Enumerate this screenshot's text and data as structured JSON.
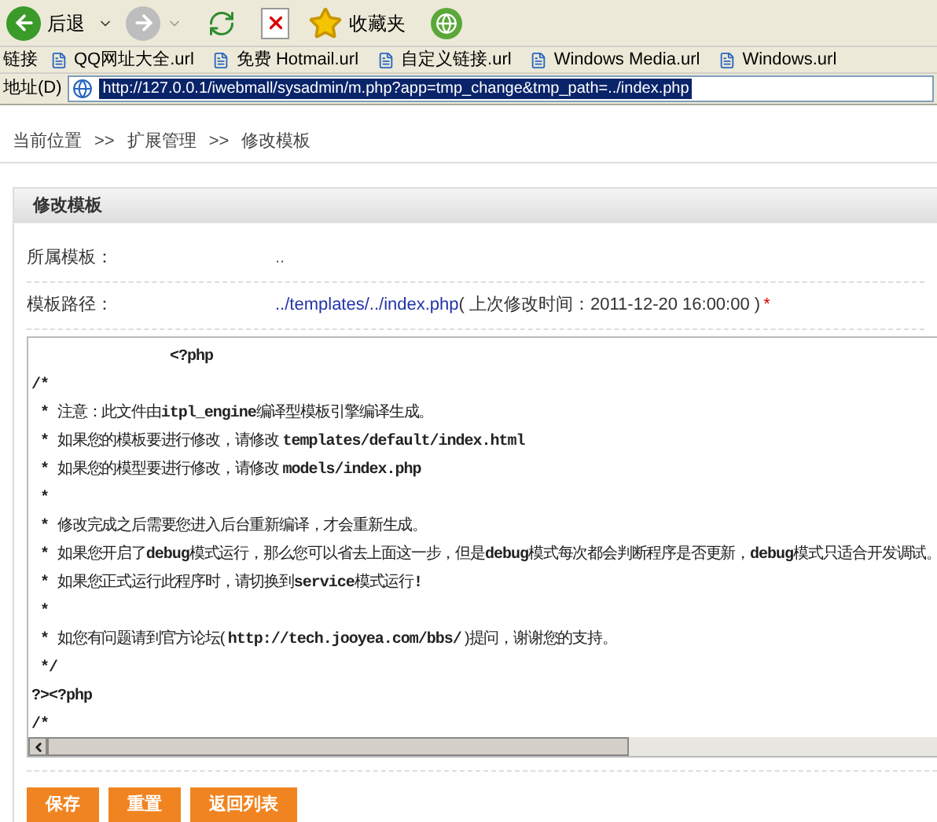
{
  "toolbar": {
    "back_label": "后退",
    "favorites_label": "收藏夹"
  },
  "links_bar": {
    "label": "链接",
    "links": [
      "QQ网址大全.url",
      "免费 Hotmail.url",
      "自定义链接.url",
      "Windows Media.url",
      "Windows.url"
    ]
  },
  "address_bar": {
    "label": "地址(D)",
    "value": "http://127.0.0.1/iwebmall/sysadmin/m.php?app=tmp_change&tmp_path=../index.php"
  },
  "breadcrumb": [
    "当前位置",
    ">>",
    "扩展管理",
    ">>",
    "修改模板"
  ],
  "panel": {
    "title": "修改模板",
    "fields": [
      {
        "label": "所属模板：",
        "value": ".."
      },
      {
        "label": "模板路径：",
        "link": "../templates/../index.php",
        "note": "( 上次修改时间：2011-12-20 16:00:00 )",
        "required": "*"
      }
    ],
    "code_lines": [
      [
        {
          "kind": "code",
          "text": "                <?php"
        }
      ],
      [
        {
          "kind": "code",
          "text": "/*"
        }
      ],
      [
        {
          "kind": "code",
          "text": " * "
        },
        {
          "kind": "text",
          "text": "注意：此文件由"
        },
        {
          "kind": "code",
          "text": "itpl_engine"
        },
        {
          "kind": "text",
          "text": "编译型模板引擎编译生成。"
        }
      ],
      [
        {
          "kind": "code",
          "text": " * "
        },
        {
          "kind": "text",
          "text": "如果您的模板要进行修改，请修改 "
        },
        {
          "kind": "code",
          "text": "templates/default/index.html"
        }
      ],
      [
        {
          "kind": "code",
          "text": " * "
        },
        {
          "kind": "text",
          "text": "如果您的模型要进行修改，请修改 "
        },
        {
          "kind": "code",
          "text": "models/index.php"
        }
      ],
      [
        {
          "kind": "code",
          "text": " *"
        }
      ],
      [
        {
          "kind": "code",
          "text": " * "
        },
        {
          "kind": "text",
          "text": "修改完成之后需要您进入后台重新编译，才会重新生成。"
        }
      ],
      [
        {
          "kind": "code",
          "text": " * "
        },
        {
          "kind": "text",
          "text": "如果您开启了"
        },
        {
          "kind": "code",
          "text": "debug"
        },
        {
          "kind": "text",
          "text": "模式运行，那么您可以省去上面这一步，但是"
        },
        {
          "kind": "code",
          "text": "debug"
        },
        {
          "kind": "text",
          "text": "模式每次都会判断程序是否更新，"
        },
        {
          "kind": "code",
          "text": "debug"
        },
        {
          "kind": "text",
          "text": "模式只适合开发调试。"
        }
      ],
      [
        {
          "kind": "code",
          "text": " * "
        },
        {
          "kind": "text",
          "text": "如果您正式运行此程序时，请切换到"
        },
        {
          "kind": "code",
          "text": "service"
        },
        {
          "kind": "text",
          "text": "模式运行"
        },
        {
          "kind": "code",
          "text": "!"
        }
      ],
      [
        {
          "kind": "code",
          "text": " *"
        }
      ],
      [
        {
          "kind": "code",
          "text": " * "
        },
        {
          "kind": "text",
          "text": "如您有问题请到官方论坛( "
        },
        {
          "kind": "code",
          "text": "http://tech.jooyea.com/bbs/"
        },
        {
          "kind": "text",
          "text": " )提问，谢谢您的支持。"
        }
      ],
      [
        {
          "kind": "code",
          "text": " */"
        }
      ],
      [
        {
          "kind": "code",
          "text": "?><?php"
        }
      ],
      [
        {
          "kind": "code",
          "text": "/*"
        }
      ]
    ],
    "buttons": [
      "保存",
      "重置",
      "返回列表"
    ]
  }
}
